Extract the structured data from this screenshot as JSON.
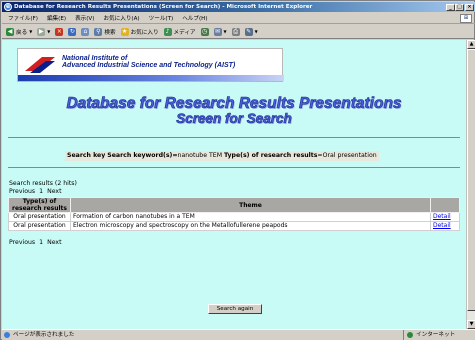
{
  "window": {
    "title": "Database for Research Results Presentations (Screen for Search) - Microsoft Internet Explorer",
    "controls": [
      "_",
      "□",
      "×"
    ]
  },
  "menu": [
    "ファイル(F)",
    "編集(E)",
    "表示(V)",
    "お気に入り(A)",
    "ツール(T)",
    "ヘルプ(H)"
  ],
  "toolbar": [
    {
      "label": "戻る",
      "icon": "back-icon"
    },
    {
      "label": "",
      "icon": "forward-icon"
    },
    {
      "label": "",
      "icon": "stop-icon"
    },
    {
      "label": "",
      "icon": "refresh-icon"
    },
    {
      "label": "",
      "icon": "home-icon"
    },
    {
      "label": "検索",
      "icon": "search-icon"
    },
    {
      "label": "お気に入り",
      "icon": "favorites-icon"
    },
    {
      "label": "メディア",
      "icon": "media-icon"
    },
    {
      "label": "",
      "icon": "history-icon"
    },
    {
      "label": "",
      "icon": "mail-icon"
    },
    {
      "label": "",
      "icon": "print-icon"
    },
    {
      "label": "",
      "icon": "edit-icon"
    }
  ],
  "banner": {
    "org_line1": "National Institute of",
    "org_line2": "Advanced Industrial Science and Technology (AIST)"
  },
  "page": {
    "heading1": "Database for Research Results Presentations",
    "heading2": "Screen for Search"
  },
  "criteria": {
    "label1": "Search key",
    "label2": "Search keyword(s)=",
    "keyword": "nanotube TEM",
    "label3": "Type(s) of research results",
    "type_value": "=Oral presentation"
  },
  "results": {
    "hits": "Search results (2 hits)",
    "prev": "Previous",
    "page": "1",
    "next": "Next",
    "columns": [
      "Type(s) of research results",
      "Theme",
      ""
    ],
    "rows": [
      {
        "type": "Oral presentation",
        "theme": "Formation of carbon nanotubes in a TEM",
        "detail": "Detail"
      },
      {
        "type": "Oral presentation",
        "theme": "Electron microscopy and spectroscopy on the Metallofullerene peapods",
        "detail": "Detail"
      }
    ]
  },
  "search_again": "Search again",
  "status": {
    "text": "ページが表示されました",
    "zone": "インターネット"
  },
  "colors": {
    "page_background": "#c9fbf6",
    "heading": "#4660d8",
    "table_header": "#a9a7a4",
    "link": "#0000ee"
  }
}
